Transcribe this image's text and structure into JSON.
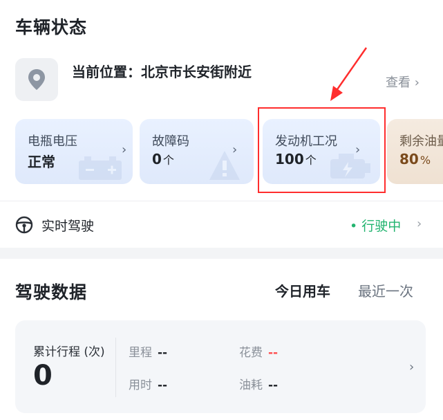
{
  "vehicle_status": {
    "title": "车辆状态",
    "location_label": "当前位置：北京市长安街附近",
    "view_link": "查看 ›",
    "cards": [
      {
        "label": "电瓶电压",
        "value": "正常",
        "unit": ""
      },
      {
        "label": "故障码",
        "value": "0",
        "unit": "个"
      },
      {
        "label": "发动机工况",
        "value": "100",
        "unit": "个"
      },
      {
        "label": "剩余油量",
        "value": "80",
        "unit": "%"
      }
    ]
  },
  "realtime": {
    "label": "实时驾驶",
    "status": "• 行驶中",
    "chevron": "›"
  },
  "driving_data": {
    "title": "驾驶数据",
    "tab_today": "今日用车",
    "tab_recent": "最近一次",
    "trip_label": "累计行程 (次)",
    "trip_value": "0",
    "metrics": {
      "mileage": {
        "label": "里程",
        "value": "--"
      },
      "cost": {
        "label": "花费",
        "value": "--"
      },
      "time": {
        "label": "用时",
        "value": "--"
      },
      "fuel": {
        "label": "油耗",
        "value": "--"
      }
    },
    "chevron": "›"
  },
  "colors": {
    "accent_green": "#22b46f",
    "annotation_red": "#ff2d2d",
    "card_blue": "#e4edfd",
    "card_beige": "#f2e6d9"
  }
}
